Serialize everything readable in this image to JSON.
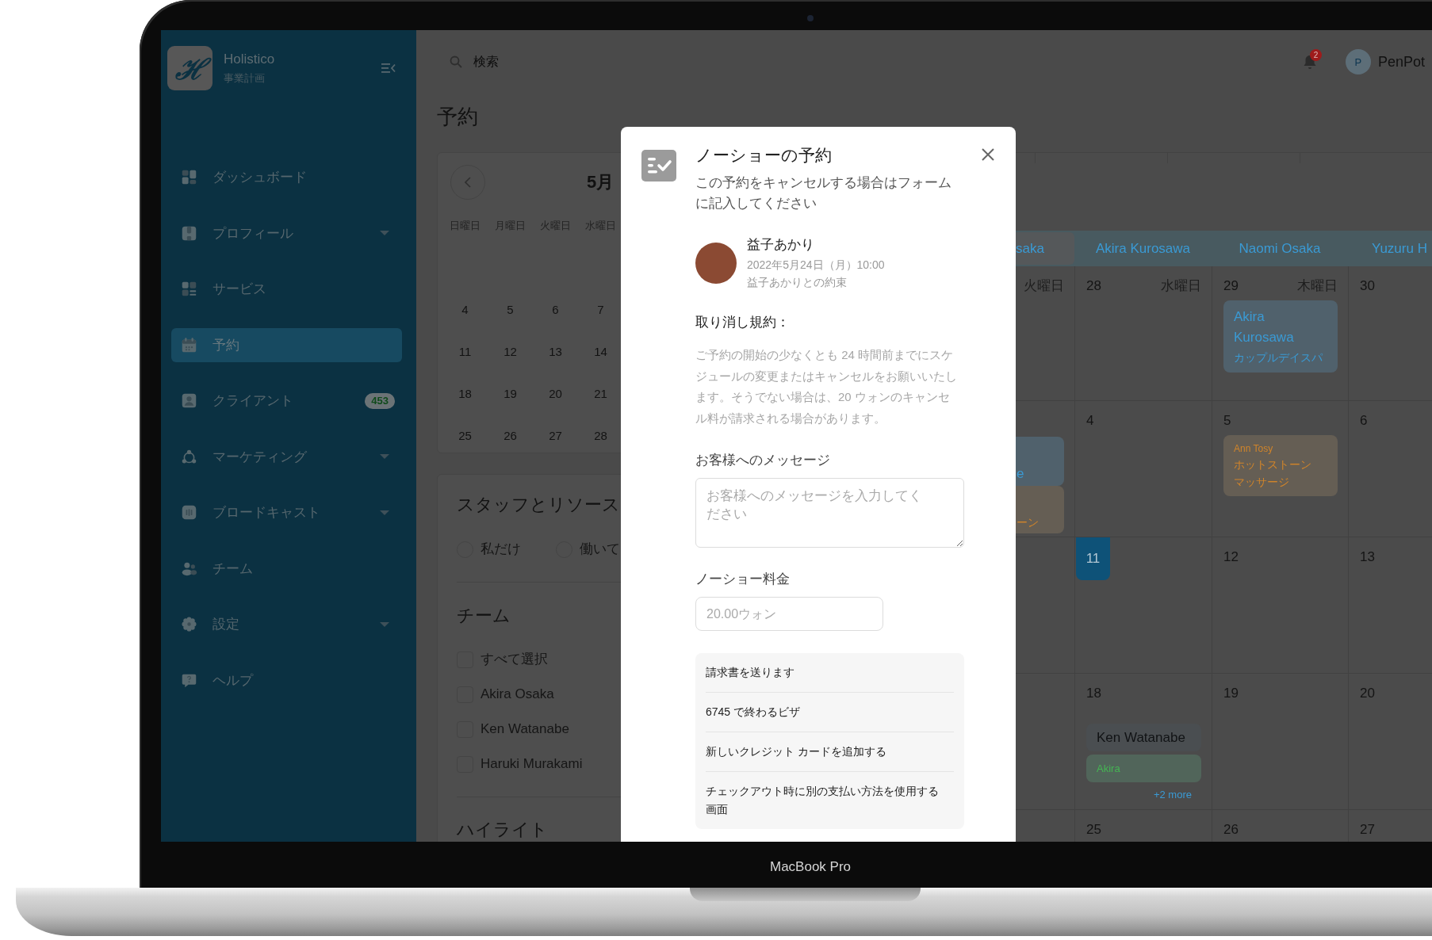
{
  "device": {
    "label": "MacBook Pro"
  },
  "sidebar": {
    "brand": {
      "mark": "ℋ",
      "name": "Holistico",
      "subtitle": "事業計画"
    },
    "items": [
      {
        "label": "ダッシュボード",
        "selected": false,
        "expandable": false
      },
      {
        "label": "プロフィール",
        "selected": false,
        "expandable": true
      },
      {
        "label": "サービス",
        "selected": false,
        "expandable": false
      },
      {
        "label": "予約",
        "selected": true,
        "expandable": false
      },
      {
        "label": "クライアント",
        "selected": false,
        "expandable": false,
        "badge": "453"
      },
      {
        "label": "マーケティング",
        "selected": false,
        "expandable": true
      },
      {
        "label": "ブロードキャスト",
        "selected": false,
        "expandable": true
      },
      {
        "label": "チーム",
        "selected": false,
        "expandable": false
      },
      {
        "label": "設定",
        "selected": false,
        "expandable": true
      },
      {
        "label": "ヘルプ",
        "selected": false,
        "expandable": false
      }
    ]
  },
  "topbar": {
    "search": {
      "placeholder": "検索"
    },
    "notifications": {
      "count": "2"
    },
    "user": {
      "initial": "P",
      "name": "PenPot"
    }
  },
  "page_title": "予約",
  "mini_calendar": {
    "month": "5月",
    "weekdays": [
      "日曜日",
      "月曜日",
      "火曜日",
      "水曜日"
    ],
    "weeks": [
      [
        "4",
        "5",
        "6",
        "7"
      ],
      [
        "11",
        "12",
        "13",
        "14"
      ],
      [
        "18",
        "19",
        "20",
        "21"
      ],
      [
        "25",
        "26",
        "27",
        "28"
      ]
    ]
  },
  "staff_panel": {
    "title": "スタッフとリソース",
    "filters": [
      {
        "label": "私だけ",
        "selected": false
      },
      {
        "label": "働いて",
        "selected": false
      }
    ],
    "team_title": "チーム",
    "members": [
      {
        "label": "すべて選択",
        "checked": false
      },
      {
        "label": "Akira Osaka",
        "checked": false
      },
      {
        "label": "Ken Watanabe",
        "checked": false
      },
      {
        "label": "Haruki Murakami",
        "checked": false
      }
    ],
    "highlights_title": "ハイライト"
  },
  "calendar": {
    "staff_tabs": [
      {
        "label": "saka",
        "selected": true
      },
      {
        "label": "Akira Kurosawa",
        "selected": false
      },
      {
        "label": "Naomi Osaka",
        "selected": false
      },
      {
        "label": "Yuzuru H",
        "selected": false
      }
    ],
    "weeks": [
      {
        "clipped": {
          "weekday": "火曜日"
        },
        "days": [
          {
            "date": "28",
            "weekday": "水曜日",
            "today": false
          },
          {
            "date": "29",
            "weekday": "木曜日",
            "today": false,
            "events": [
              {
                "kind": "booking",
                "title": "Akira Kurosawa",
                "service": "カップルデイスパ",
                "color": "#3a9ad4"
              }
            ]
          },
          {
            "date": "30",
            "today": false
          }
        ]
      },
      {
        "clipped": {
          "events": [
            {
              "kind": "fragment",
              "title": "e",
              "color": "#3a9ad4"
            },
            {
              "kind": "fragment",
              "service": "ーン",
              "color": "#d0842a"
            }
          ]
        },
        "days": [
          {
            "date": "4",
            "today": false
          },
          {
            "date": "5",
            "today": false,
            "events": [
              {
                "kind": "session",
                "client": "Ann Tosy",
                "service": "ホットストーンマッサージ",
                "color": "#d0842a"
              }
            ]
          },
          {
            "date": "6",
            "today": false
          }
        ]
      },
      {
        "days": [
          {
            "date": "11",
            "today": true
          },
          {
            "date": "12",
            "today": false
          },
          {
            "date": "13",
            "today": false
          }
        ]
      },
      {
        "days": [
          {
            "date": "18",
            "today": false,
            "events": [
              {
                "kind": "pill",
                "title": "Ken Watanabe",
                "color": "#111315"
              },
              {
                "kind": "pill",
                "client": "Akira",
                "color": "#45b553"
              }
            ],
            "more": "+2 more"
          },
          {
            "date": "19",
            "today": false
          },
          {
            "date": "20",
            "today": false
          }
        ]
      },
      {
        "days": [
          {
            "date": "25",
            "today": false
          },
          {
            "date": "26",
            "today": false
          },
          {
            "date": "27",
            "today": false
          }
        ]
      }
    ]
  },
  "modal": {
    "title": "ノーショーの予約",
    "subtitle": "この予約をキャンセルする場合はフォームに記入してください",
    "client": {
      "name": "益子あかり",
      "datetime": "2022年5月24日（月）10:00",
      "appointment": "益子あかりとの約束"
    },
    "policy_title": "取り消し規約：",
    "policy": "ご予約の開始の少なくとも 24 時間前までにスケジュールの変更またはキャンセルをお願いいたします。そうでない場合は、20 ウォンのキャンセル料が請求される場合があります。",
    "message": {
      "label": "お客様へのメッセージ",
      "placeholder": "お客様へのメッセージを入力してください"
    },
    "fee": {
      "label": "ノーショー料金",
      "placeholder": "20.00ウォン"
    },
    "payment_options": [
      "請求書を送ります",
      "6745 で終わるビザ",
      "新しいクレジット カードを追加する",
      "チェックアウト時に別の支払い方法を使用する画面"
    ]
  }
}
